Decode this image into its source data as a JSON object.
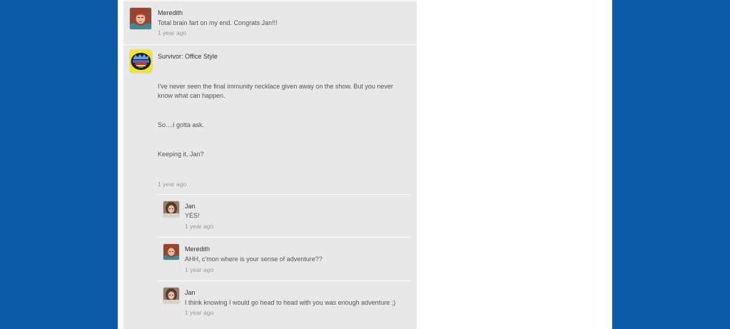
{
  "comments": [
    {
      "author": "Meredith",
      "avatar_icon": "redhead-woman-avatar-icon",
      "text": "Total brain fart on my end.  Congrats Jan!!!",
      "time": "1 year ago"
    },
    {
      "author": "Survivor: Office Style",
      "avatar_icon": "survivor-logo-avatar-icon",
      "paragraphs": [
        "I've never seen the final immunity necklace given away on the show.  But you never",
        "know what can happen.",
        "So....I gotta ask.",
        "Keeping it, Jan?"
      ],
      "time": "1 year ago",
      "replies": [
        {
          "author": "Jan",
          "avatar_icon": "brunette-woman-avatar-icon",
          "text": "YES!",
          "time": "1 year ago"
        },
        {
          "author": "Meredith",
          "avatar_icon": "redhead-woman-avatar-icon",
          "text": "AHH, c'mon where is your sense of adventure??",
          "time": "1 year ago"
        },
        {
          "author": "Jan",
          "avatar_icon": "brunette-woman-avatar-icon",
          "text": "I think knowing I would go head to head with you was enough adventure ;)",
          "time": "1 year ago"
        }
      ]
    }
  ],
  "colors": {
    "background": "#0a5aa8",
    "page": "#ffffff",
    "feed": "#e8e8e8",
    "name": "#333333",
    "text": "#555555",
    "time": "#9a9a9a"
  }
}
